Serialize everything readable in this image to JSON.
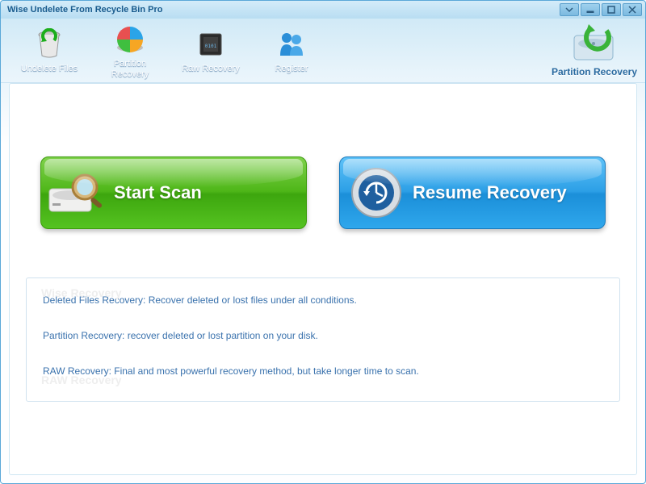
{
  "window": {
    "title": "Wise Undelete From Recycle Bin Pro"
  },
  "toolbar": {
    "items": [
      {
        "label": "Undelete Files"
      },
      {
        "label": "Partition\nRecovery"
      },
      {
        "label": "Raw Recovery"
      },
      {
        "label": "Register"
      }
    ],
    "right_label": "Partition Recovery"
  },
  "main": {
    "start_scan_label": "Start  Scan",
    "resume_recovery_label": "Resume Recovery"
  },
  "info": {
    "line1": "Deleted Files Recovery: Recover deleted or lost files  under all conditions.",
    "line2": "Partition Recovery: recover deleted or lost partition on your disk.",
    "line3": "RAW Recovery: Final and most powerful recovery method, but take longer time to scan."
  },
  "ghost": {
    "g1": "Wise Recovery",
    "g2": "RAW Recovery"
  },
  "colors": {
    "accent_green": "#4eb618",
    "accent_blue": "#2c9fe6",
    "frame": "#b8ddf2",
    "text_link": "#3a72ad"
  }
}
